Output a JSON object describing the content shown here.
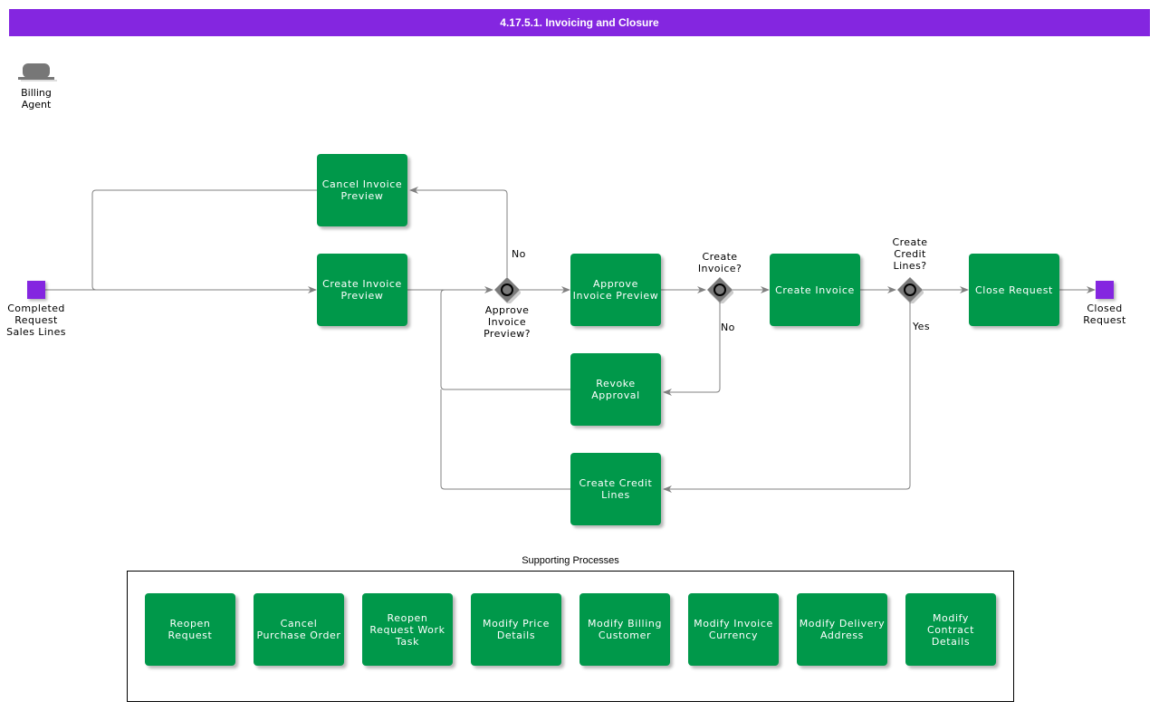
{
  "title": "4.17.5.1. Invoicing and Closure",
  "actor": {
    "label": "Billing Agent",
    "icon": "bowler-hat-icon"
  },
  "events": {
    "start": {
      "label": "Completed Request Sales Lines"
    },
    "end": {
      "label": "Closed Request"
    }
  },
  "tasks": {
    "cancel_invoice_preview": "Cancel Invoice Preview",
    "create_invoice_preview": "Create Invoice Preview",
    "approve_invoice_preview": "Approve Invoice Preview",
    "revoke_approval": "Revoke Approval",
    "create_credit_lines": "Create Credit Lines",
    "create_invoice": "Create Invoice",
    "close_request": "Close Request"
  },
  "gateways": {
    "approve": {
      "label": "Approve Invoice Preview?",
      "branch_label": "No"
    },
    "create_invoice": {
      "label": "Create Invoice?",
      "branch_label": "No"
    },
    "credit_lines": {
      "label": "Create Credit Lines?",
      "branch_label": "Yes"
    }
  },
  "supporting": {
    "title": "Supporting Processes",
    "items": [
      "Reopen Request",
      "Cancel Purchase Order",
      "Reopen Request Work Task",
      "Modify Price Details",
      "Modify Billing Customer",
      "Modify Invoice Currency",
      "Modify Delivery Address",
      "Modify Contract Details"
    ]
  },
  "colors": {
    "title_bar": "#8426e0",
    "task": "#00984a",
    "event": "#8426e0",
    "gateway": "#7a7a7a",
    "flow": "#808080"
  }
}
